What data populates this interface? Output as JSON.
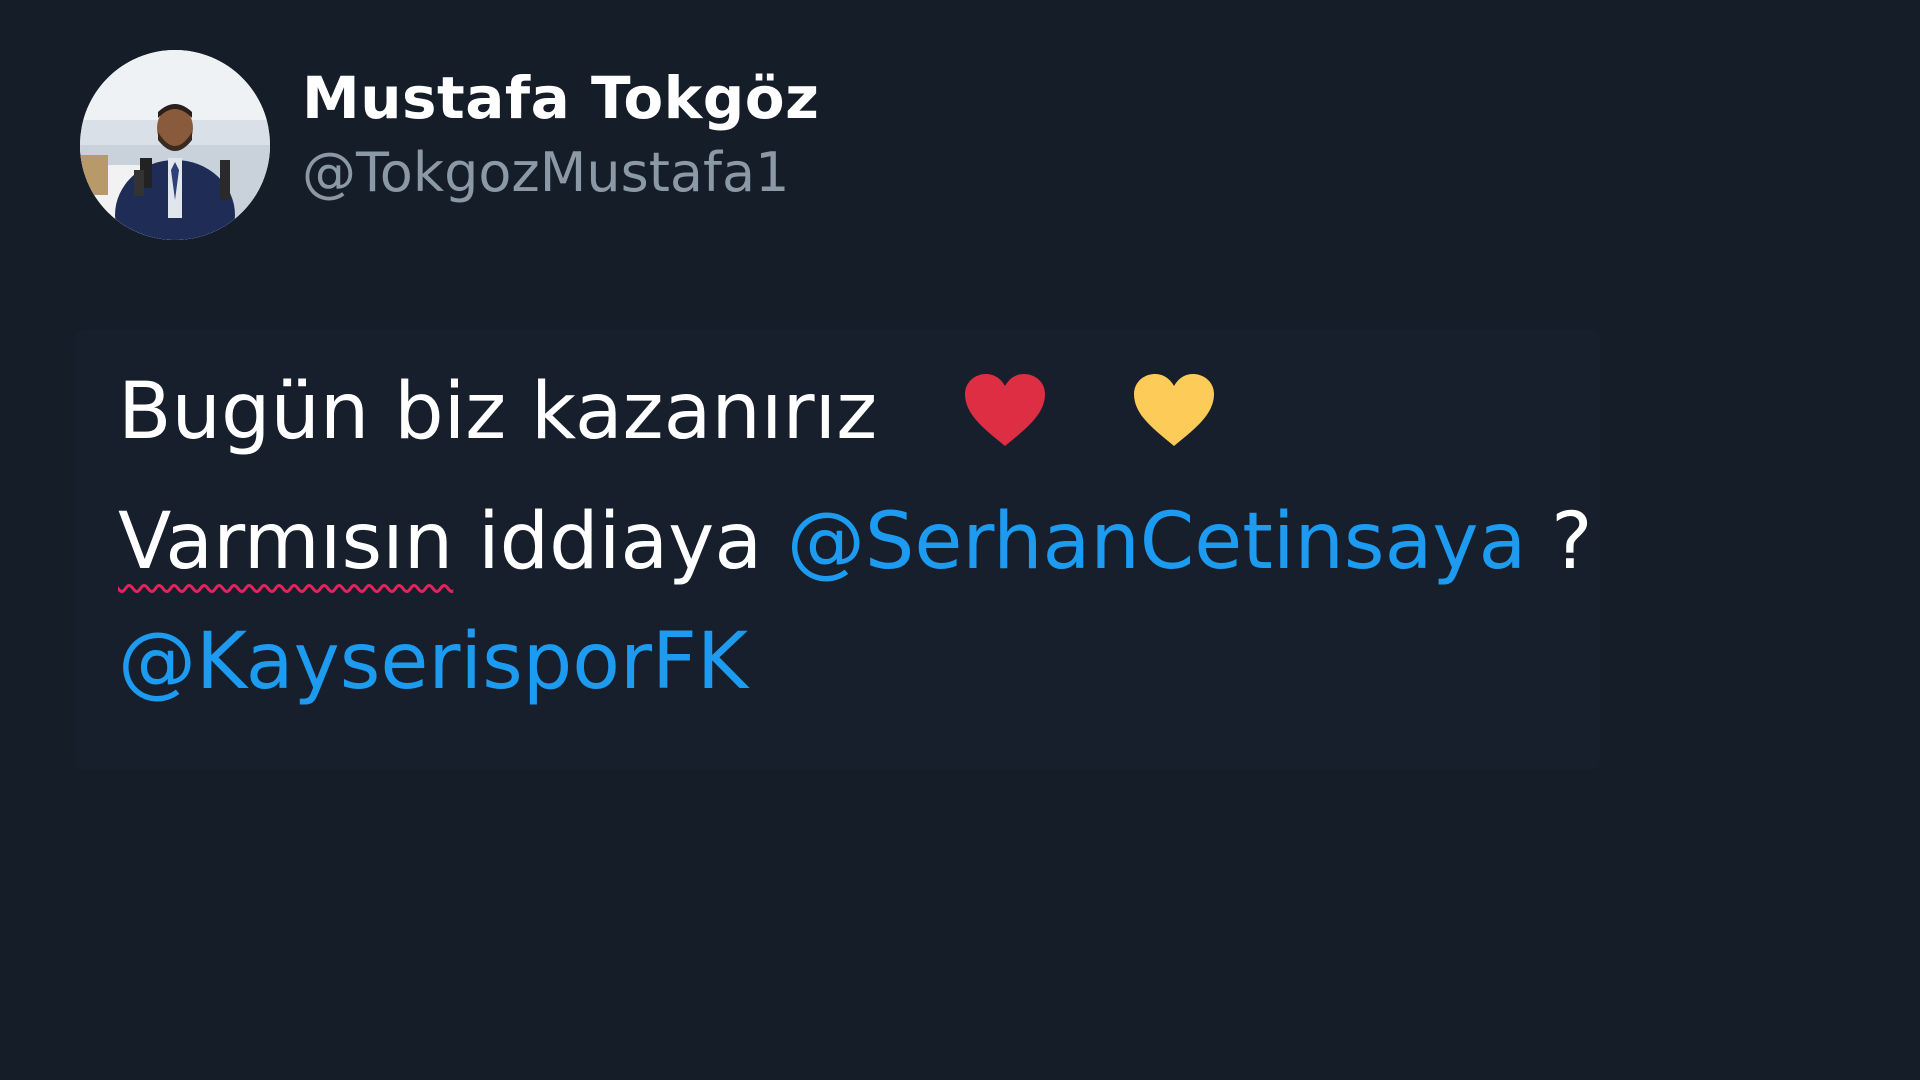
{
  "author": {
    "display_name": "Mustafa Tokgöz",
    "handle": "@TokgozMustafa1"
  },
  "tweet": {
    "line1_text": "Bugün biz kazanırız",
    "line1_emojis": [
      "red-heart-icon",
      "yellow-heart-icon"
    ],
    "line2_word1": "Varmısın",
    "line2_word2": " iddiaya ",
    "line2_mention": "@SerhanCetinsaya",
    "line2_suffix": " ?",
    "line3_mention": "@KayserisporFK"
  },
  "colors": {
    "background": "#151d29",
    "name": "#ffffff",
    "handle": "#8b98a5",
    "mention": "#1d9bf0",
    "red_heart": "#dd2e44",
    "yellow_heart": "#fdcb58"
  }
}
